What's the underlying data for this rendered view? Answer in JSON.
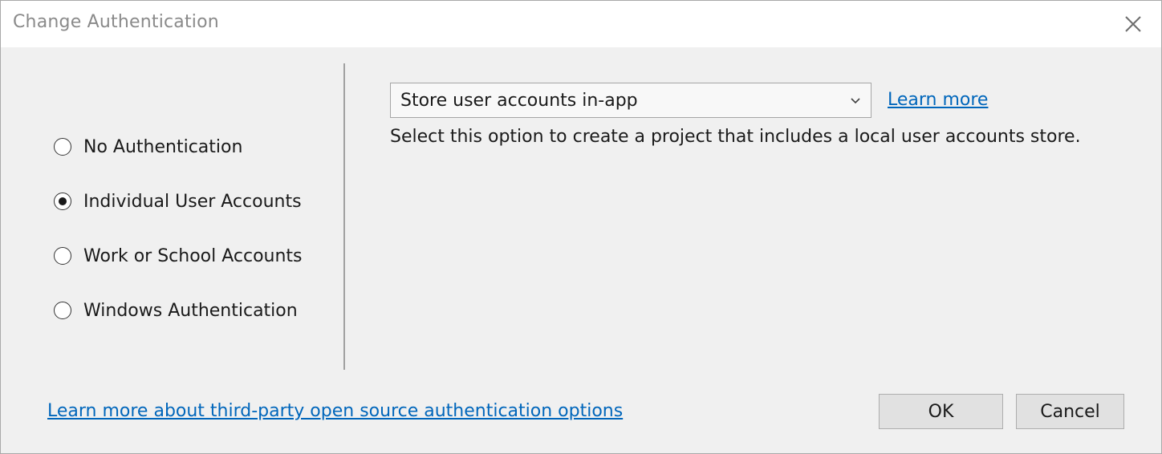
{
  "window": {
    "title": "Change Authentication"
  },
  "auth_options": [
    {
      "label": "No Authentication",
      "selected": false
    },
    {
      "label": "Individual User Accounts",
      "selected": true
    },
    {
      "label": "Work or School Accounts",
      "selected": false
    },
    {
      "label": "Windows Authentication",
      "selected": false
    }
  ],
  "store": {
    "selected_value": "Store user accounts in-app",
    "learn_more": "Learn more",
    "description": "Select this option to create a project that includes a local user accounts store."
  },
  "footer": {
    "third_party_link": "Learn more about third-party open source authentication options",
    "ok_label": "OK",
    "cancel_label": "Cancel"
  },
  "icons": {
    "close": "close-icon",
    "dropdown": "chevron-down-icon"
  },
  "colors": {
    "link": "#0066bb",
    "title_text": "#8a8a8a",
    "background": "#f0f0f0"
  }
}
